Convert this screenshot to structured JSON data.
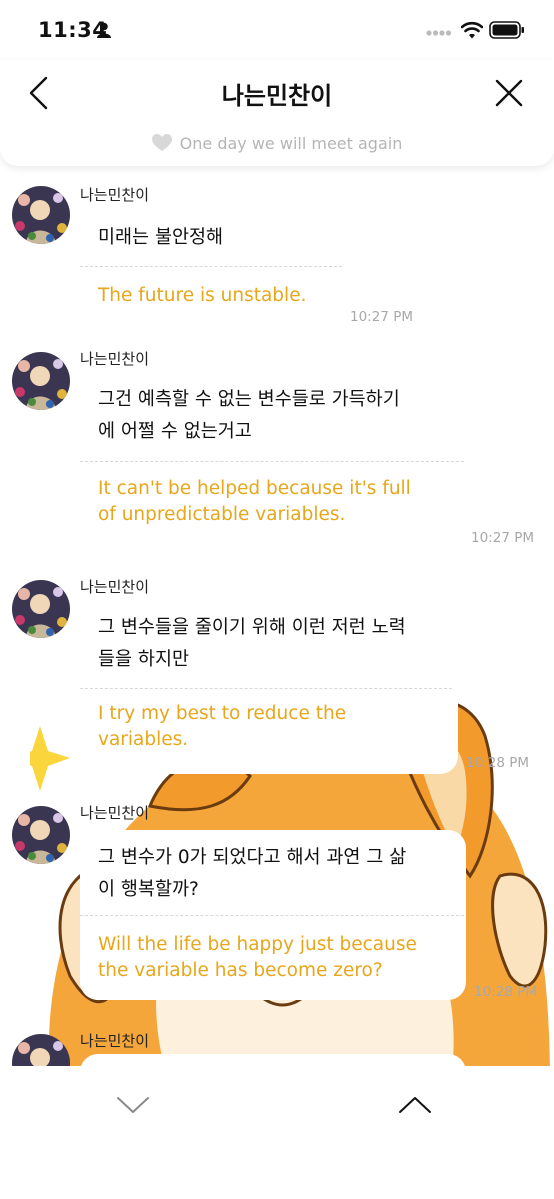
{
  "status_bar": {
    "time": "11:34"
  },
  "header": {
    "title": "나는민찬이",
    "subtitle": "One day we will meet again"
  },
  "messages": [
    {
      "sender": "나는민찬이",
      "korean": [
        "미래는 불안정해"
      ],
      "english": [
        "The future is unstable."
      ],
      "time": "10:27 PM"
    },
    {
      "sender": "나는민찬이",
      "korean": [
        "그건 예측할 수 없는 변수들로 가득하기",
        "에 어쩔 수 없는거고"
      ],
      "english": [
        "It can't be helped because it's full",
        "of unpredictable variables."
      ],
      "time": "10:27 PM"
    },
    {
      "sender": "나는민찬이",
      "korean": [
        "그 변수들을 줄이기 위해 이런 저런 노력",
        "들을 하지만"
      ],
      "english": [
        "I try my best to reduce the",
        "variables."
      ],
      "time": "10:28 PM"
    },
    {
      "sender": "나는민찬이",
      "korean": [
        "그 변수가 0가 되었다고 해서 과연 그 삶",
        "이 행복할까?"
      ],
      "english": [
        "Will the life be happy just because",
        "the variable has become zero?"
      ],
      "time": "10:28 PM"
    },
    {
      "sender": "나는민찬이"
    }
  ],
  "colors": {
    "translation": "#e8a61a",
    "timestamp": "#a8a8a8",
    "subtitle": "#b5b5b5"
  },
  "icons": {
    "back": "chevron-left-icon",
    "close": "close-icon",
    "heart": "heart-icon",
    "scroll_down": "chevron-down-icon",
    "scroll_up": "chevron-up-icon"
  }
}
